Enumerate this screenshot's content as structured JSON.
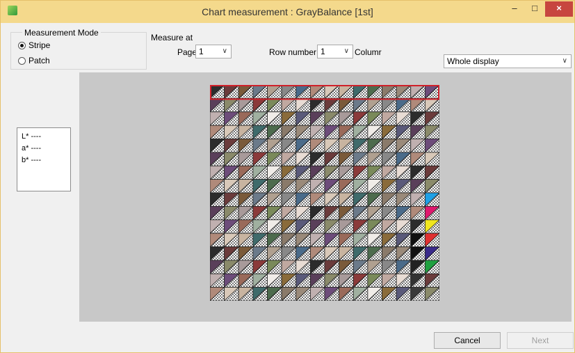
{
  "window": {
    "title": "Chart measurement : GrayBalance [1st]",
    "minimize_label": "–",
    "maximize_label": "□",
    "close_label": "×"
  },
  "measurement_mode": {
    "group_label": "Measurement Mode",
    "options": [
      {
        "label": "Stripe",
        "selected": true
      },
      {
        "label": "Patch",
        "selected": false
      }
    ]
  },
  "measure_at": {
    "label": "Measure at",
    "page_label": "Page",
    "page_value": "1",
    "row_label": "Row number",
    "row_value": "1",
    "column_label": "Columr"
  },
  "display_select": {
    "value": "Whole display"
  },
  "values": {
    "l": "L* ----",
    "a": "a* ----",
    "b": "b* ----"
  },
  "buttons": {
    "cancel": "Cancel",
    "next": "Next"
  },
  "chart_grid": {
    "rows": 15,
    "cols": 16,
    "selected_row": 1,
    "highlight_color": "#d0202a",
    "palette": [
      "#2c2c2c",
      "#8a6b3a",
      "#3f6b6b",
      "#6b3b3b",
      "#5a5a7a",
      "#4d6b4d",
      "#7a5a3a",
      "#5a3f5a",
      "#8a7a6a",
      "#6b7a8a",
      "#8a8a6a",
      "#9a8a7a",
      "#b0a090",
      "#a89a9a",
      "#c0b0b0",
      "#888888",
      "#8b3a3a",
      "#6d4c7a",
      "#4a6b8a",
      "#7a8a5a",
      "#9a6a5a",
      "#b08a7a",
      "#c0a8a0",
      "#a0b0a0",
      "#d8c8b8",
      "#e8dcd4",
      "#f0ece8",
      "#c8b4a0"
    ],
    "special_cells": [
      {
        "row": 8,
        "col": 15,
        "color": "#1ea0e6"
      },
      {
        "row": 9,
        "col": 15,
        "color": "#e0186e"
      },
      {
        "row": 10,
        "col": 15,
        "color": "#f0e61e"
      },
      {
        "row": 11,
        "col": 14,
        "color": "#111111"
      },
      {
        "row": 11,
        "col": 15,
        "color": "#e03030"
      },
      {
        "row": 12,
        "col": 14,
        "color": "#111111"
      },
      {
        "row": 12,
        "col": 15,
        "color": "#3a2a8a"
      },
      {
        "row": 13,
        "col": 14,
        "color": "#222222"
      },
      {
        "row": 13,
        "col": 15,
        "color": "#20a040"
      },
      {
        "row": 14,
        "col": 14,
        "color": "#333333"
      },
      {
        "row": 15,
        "col": 14,
        "color": "#3a3a3a"
      }
    ]
  }
}
